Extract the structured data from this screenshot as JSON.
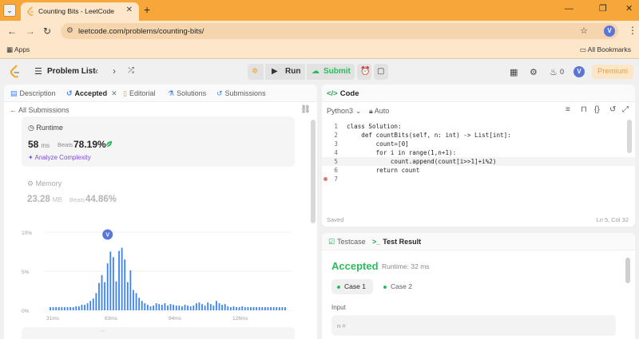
{
  "browser": {
    "tab_title": "Counting Bits - LeetCode",
    "url": "leetcode.com/problems/counting-bits/",
    "profile_initial": "V",
    "bookmarks": {
      "apps": "Apps",
      "all_bookmarks": "All Bookmarks"
    }
  },
  "topbar": {
    "problem_list": "Problem List",
    "run": "Run",
    "submit": "Submit",
    "streak": "0",
    "avatar": "V",
    "premium": "Premium"
  },
  "left_tabs": [
    {
      "label": "Description",
      "icon": "description-icon"
    },
    {
      "label": "Accepted",
      "icon": "history-icon"
    },
    {
      "label": "Editorial",
      "icon": "book-icon"
    },
    {
      "label": "Solutions",
      "icon": "flask-icon"
    },
    {
      "label": "Submissions",
      "icon": "history-icon"
    }
  ],
  "submission": {
    "back_label": "All Submissions",
    "runtime_label": "Runtime",
    "runtime_value": "58",
    "runtime_unit": "ms",
    "beats_label": "Beats",
    "runtime_beats": "78.19%",
    "analyze": "Analyze Complexity",
    "memory_label": "Memory",
    "memory_value": "23.28",
    "memory_unit": "MB",
    "memory_beats": "44.86%"
  },
  "chart_data": {
    "type": "bar",
    "title": "",
    "xlabel": "",
    "ylabel": "",
    "y_ticks": [
      "10%",
      "5%",
      "0%"
    ],
    "x_ticks": [
      "31ms",
      "83ms",
      "84ms",
      "126ms"
    ],
    "ylim": [
      0,
      10
    ],
    "marker_label": "V",
    "marker_bar_index": 20,
    "values": [
      0.4,
      0.4,
      0.4,
      0.4,
      0.4,
      0.4,
      0.4,
      0.4,
      0.4,
      0.5,
      0.5,
      0.7,
      0.7,
      0.9,
      1.2,
      1.5,
      2.2,
      3.5,
      4.5,
      3.6,
      6.0,
      7.5,
      6.8,
      3.7,
      7.6,
      8.0,
      6.5,
      3.6,
      5.1,
      2.6,
      2.2,
      1.6,
      1.2,
      0.9,
      0.7,
      0.5,
      0.6,
      0.9,
      0.8,
      0.7,
      0.9,
      0.6,
      0.8,
      0.7,
      0.6,
      0.6,
      0.5,
      0.7,
      0.6,
      0.5,
      0.6,
      0.9,
      1.0,
      0.8,
      0.6,
      1.0,
      0.8,
      0.6,
      1.2,
      0.9,
      0.7,
      0.8,
      0.5,
      0.4,
      0.5,
      0.4,
      0.4,
      0.5,
      0.4,
      0.4,
      0.4,
      0.4,
      0.4,
      0.4,
      0.4,
      0.4,
      0.4,
      0.4,
      0.4,
      0.4,
      0.4,
      0.4,
      0.4
    ]
  },
  "editor": {
    "title": "Code",
    "language": "Python3",
    "auto": "Auto",
    "lines": [
      "class Solution:",
      "    def countBits(self, n: int) -> List[int]:",
      "        count=[0]",
      "        for i in range(1,n+1):",
      "            count.append(count[i>>1]+i%2)",
      "        return count",
      ""
    ],
    "line_numbers": [
      "1",
      "2",
      "3",
      "4",
      "5",
      "6",
      "7"
    ],
    "status": "Saved",
    "cursor": "Ln 5, Col 32"
  },
  "result": {
    "testcase_tab": "Testcase",
    "result_tab": "Test Result",
    "status": "Accepted",
    "runtime": "Runtime: 32 ms",
    "cases": [
      "Case 1",
      "Case 2"
    ],
    "input_label": "Input",
    "input_value": "n ="
  },
  "colors": {
    "accent_orange": "#f7a73a",
    "accepted_green": "#2cbb5d",
    "bar_blue": "#3b82f6",
    "marker": "#5b76d6"
  }
}
